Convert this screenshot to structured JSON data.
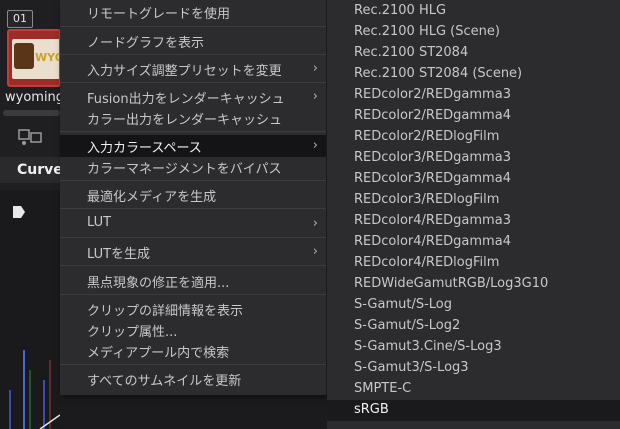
{
  "clip": {
    "number": "01",
    "name": "wyoming",
    "logo_text": "WYO"
  },
  "tab": {
    "curves_label": "Curves"
  },
  "menu": {
    "items": [
      {
        "label": "リモートグレードを使用",
        "submenu": false
      },
      {
        "label": "ノードグラフを表示",
        "submenu": false
      },
      {
        "label": "入力サイズ調整プリセットを変更",
        "submenu": true
      },
      {
        "label": "Fusion出力をレンダーキャッシュ",
        "submenu": true
      },
      {
        "label": "カラー出力をレンダーキャッシュ",
        "submenu": false
      },
      {
        "label": "入力カラースペース",
        "submenu": true,
        "active": true
      },
      {
        "label": "カラーマネージメントをバイパス",
        "submenu": false
      },
      {
        "label": "最適化メディアを生成",
        "submenu": false
      },
      {
        "label": "LUT",
        "submenu": true
      },
      {
        "label": "LUTを生成",
        "submenu": true
      },
      {
        "label": "黒点現象の修正を適用...",
        "submenu": false
      },
      {
        "label": "クリップの詳細情報を表示",
        "submenu": false
      },
      {
        "label": "クリップ属性...",
        "submenu": false
      },
      {
        "label": "メディアプール内で検索",
        "submenu": false
      },
      {
        "label": "すべてのサムネイルを更新",
        "submenu": false
      }
    ],
    "arrow": "›"
  },
  "submenu": {
    "items": [
      "Rec.2100 HLG",
      "Rec.2100 HLG (Scene)",
      "Rec.2100 ST2084",
      "Rec.2100 ST2084 (Scene)",
      "REDcolor2/REDgamma3",
      "REDcolor2/REDgamma4",
      "REDcolor2/REDlogFilm",
      "REDcolor3/REDgamma3",
      "REDcolor3/REDgamma4",
      "REDcolor3/REDlogFilm",
      "REDcolor4/REDgamma3",
      "REDcolor4/REDgamma4",
      "REDcolor4/REDlogFilm",
      "REDWideGamutRGB/Log3G10",
      "S-Gamut/S-Log",
      "S-Gamut/S-Log2",
      "S-Gamut3.Cine/S-Log3",
      "S-Gamut3/S-Log3",
      "SMPTE-C",
      "sRGB"
    ],
    "active_index": 19
  }
}
